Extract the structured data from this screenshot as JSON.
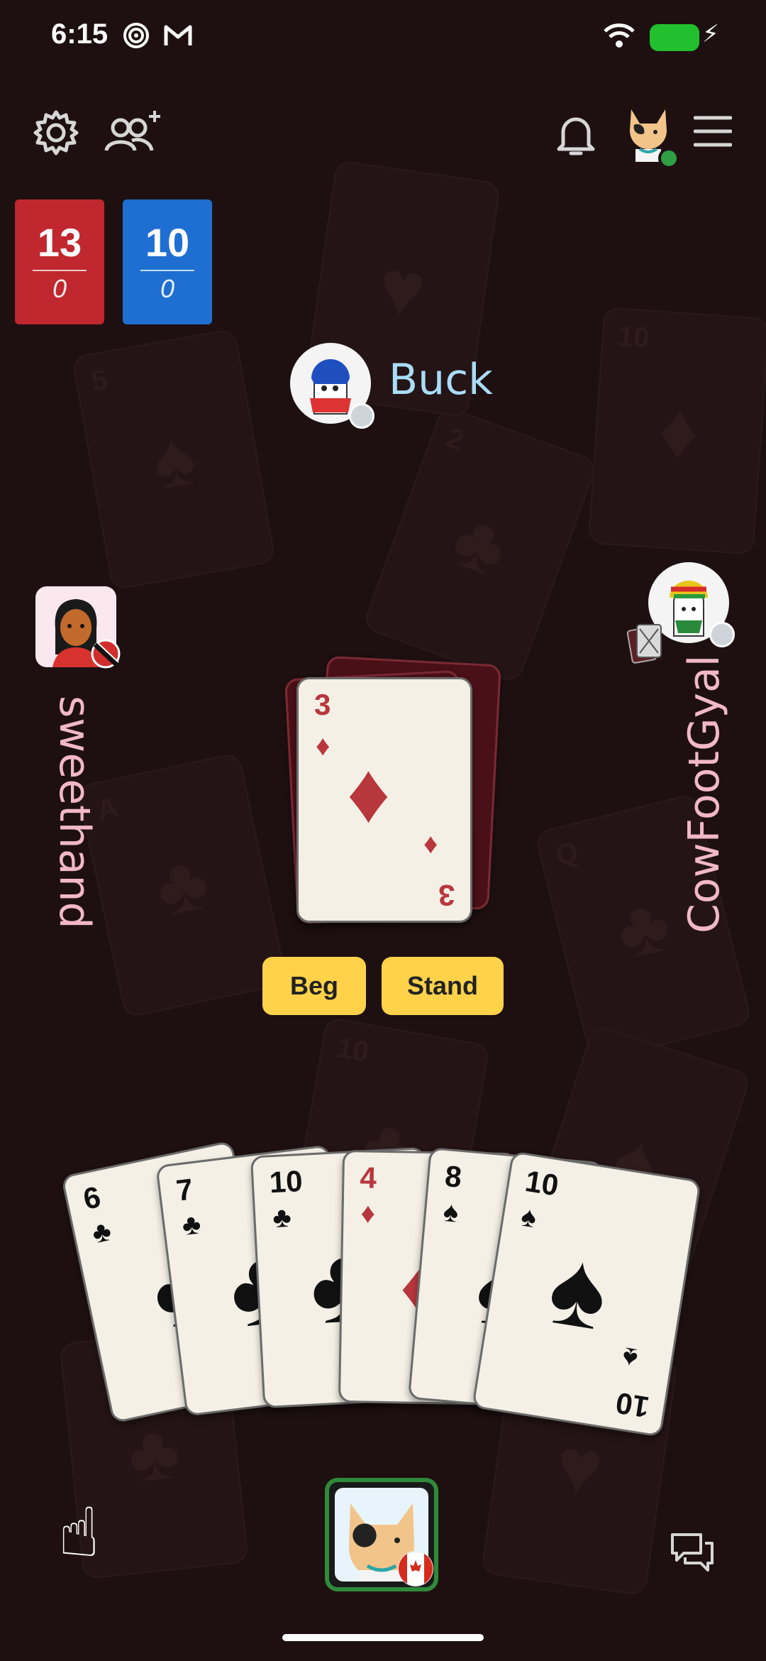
{
  "status_bar": {
    "time": "6:15"
  },
  "scores": [
    {
      "main": "13",
      "sub": "0",
      "color": "#c0272e"
    },
    {
      "main": "10",
      "sub": "0",
      "color": "#1e6fd1"
    }
  ],
  "players": {
    "top": {
      "name": "Buck"
    },
    "left": {
      "name": "sweethand"
    },
    "right": {
      "name": "CowFootGyal"
    }
  },
  "trick_card": {
    "rank": "3",
    "suit": "♦",
    "color": "red"
  },
  "actions": {
    "beg_label": "Beg",
    "stand_label": "Stand"
  },
  "hand": [
    {
      "rank": "6",
      "suit": "♣"
    },
    {
      "rank": "7",
      "suit": "♣"
    },
    {
      "rank": "10",
      "suit": "♣"
    },
    {
      "rank": "4",
      "suit": "♦"
    },
    {
      "rank": "8",
      "suit": "♠"
    },
    {
      "rank": "10",
      "suit": "♠"
    }
  ],
  "icons": {
    "settings": "gear-icon",
    "friends": "add-friends-icon",
    "notifications": "bell-icon",
    "menu": "hamburger-menu-icon",
    "chat": "chat-icon",
    "hand_pointer": "pointing-finger-icon"
  },
  "colors": {
    "accent": "#ffd24a",
    "background": "#1e1011",
    "online": "#2ea043"
  }
}
